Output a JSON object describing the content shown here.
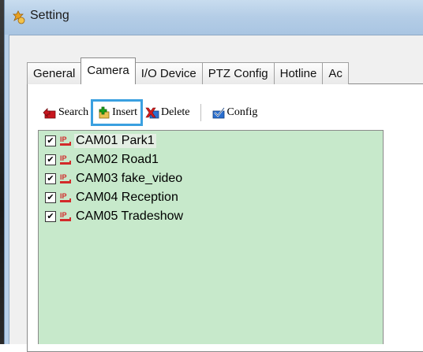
{
  "window": {
    "title": "Setting"
  },
  "tabs": [
    "General",
    "Camera",
    "I/O Device",
    "PTZ Config",
    "Hotline",
    "Ac"
  ],
  "active_tab": "Camera",
  "toolbar": {
    "search_label": "Search",
    "insert_label": "Insert",
    "delete_label": "Delete",
    "config_label": "Config"
  },
  "cameras": [
    {
      "label": "CAM01 Park1",
      "checked": true
    },
    {
      "label": "CAM02 Road1",
      "checked": true
    },
    {
      "label": "CAM03 fake_video",
      "checked": true
    },
    {
      "label": "CAM04 Reception",
      "checked": true
    },
    {
      "label": "CAM05 Tradeshow",
      "checked": true
    }
  ],
  "icons": {
    "checkmark": "✔",
    "ip_badge_text": "IP"
  },
  "colors": {
    "list_background": "#c7e9cb",
    "highlight_border": "#3aa0e0",
    "ip_icon": "#d22a2a",
    "insert_plus": "#1aa41a",
    "search_arrow": "#c8161e",
    "delete_x": "#d81b1b"
  }
}
